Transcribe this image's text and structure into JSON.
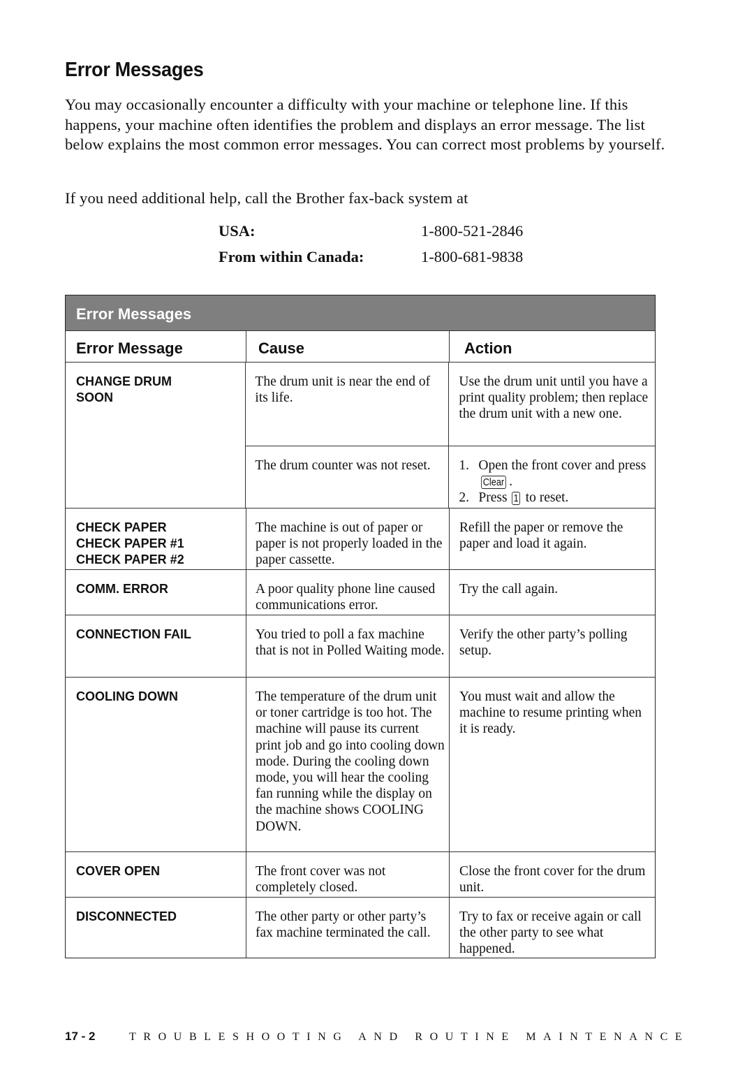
{
  "page": {
    "title": "Error Messages",
    "intro": "You may occasionally encounter a difficulty with your machine or telephone line. If this happens, your machine often identifies the problem and displays an error message. The list below explains the most common error messages. You can correct most problems by yourself.",
    "help_text": "If you need additional help, call the Brother fax-back system at",
    "contacts": [
      {
        "label": "USA:",
        "number": "1-800-521-2846"
      },
      {
        "label": "From within Canada:",
        "number": "1-800-681-9838"
      }
    ]
  },
  "table": {
    "banner": "Error Messages",
    "columns": [
      "Error Message",
      "Cause",
      "Action"
    ],
    "rows": {
      "change_drum": {
        "message_lines": [
          "CHANGE DRUM",
          "SOON"
        ],
        "causes": [
          {
            "cause": "The drum unit is near the end of its life.",
            "action": "Use the drum unit until you have a print quality problem; then replace the drum unit with a new one."
          },
          {
            "cause": "The drum counter was not reset.",
            "action_steps": [
              {
                "num": "1.",
                "before": "Open the front cover and press",
                "key": "Clear",
                "after": "."
              },
              {
                "num": "2.",
                "before": "Press",
                "key": "1",
                "after": "to reset."
              }
            ]
          }
        ]
      },
      "check_paper": {
        "message_lines": [
          "CHECK PAPER",
          "CHECK PAPER #1",
          "CHECK PAPER #2"
        ],
        "cause": "The machine is out of paper or paper is not properly loaded in the paper cassette.",
        "action": "Refill the paper or remove the paper and load it again."
      },
      "comm_error": {
        "message_lines": [
          "COMM. ERROR"
        ],
        "cause": "A poor quality phone line caused communications error.",
        "action": "Try the call again."
      },
      "connection_fail": {
        "message_lines": [
          "CONNECTION FAIL"
        ],
        "cause": "You tried to poll a fax machine that is not in Polled Waiting mode.",
        "action": "Verify the other party’s polling setup."
      },
      "cooling_down": {
        "message_lines": [
          "COOLING DOWN"
        ],
        "cause": "The temperature of the drum unit or toner cartridge is too hot. The machine will pause its current print job and go into cooling down mode. During the cooling down mode, you will hear the cooling fan running while the display on the machine shows COOLING DOWN.",
        "action": "You must wait and allow the machine to resume printing when it is ready."
      },
      "cover_open": {
        "message_lines": [
          "COVER OPEN"
        ],
        "cause": "The front cover was not completely closed.",
        "action": "Close the front cover for the drum unit."
      },
      "disconnected": {
        "message_lines": [
          "DISCONNECTED"
        ],
        "cause": "The other party or other party’s fax machine terminated the call.",
        "action": "Try to fax or receive again or call the other party to see what happened."
      }
    }
  },
  "footer": {
    "page_number": "17 - 2",
    "chapter": "TROUBLESHOOTING AND ROUTINE MAINTENANCE"
  }
}
